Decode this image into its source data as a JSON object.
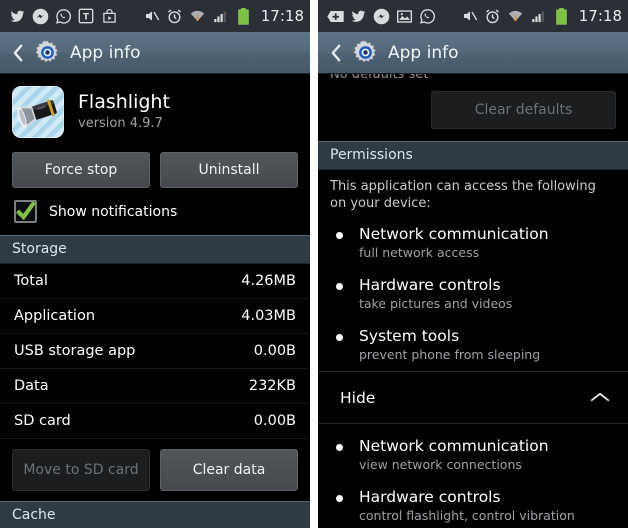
{
  "left": {
    "statusbar": {
      "icons": [
        "twitter-icon",
        "messenger-icon",
        "whatsapp-icon",
        "tumblr-icon",
        "play-store-icon",
        "mute-icon",
        "alarm-icon",
        "wifi-icon",
        "signal-icon",
        "battery-icon"
      ],
      "time": "17:18"
    },
    "actionbar": {
      "back_icon": "back-chevron-icon",
      "app_icon": "settings-gear-icon",
      "title": "App info"
    },
    "app": {
      "icon": "flashlight-app-icon",
      "name": "Flashlight",
      "version": "version 4.9.7"
    },
    "buttons": {
      "force_stop": "Force stop",
      "uninstall": "Uninstall"
    },
    "notifications": {
      "label": "Show notifications",
      "checked": true,
      "check_color": "#7cc142"
    },
    "storage": {
      "header": "Storage",
      "rows": [
        {
          "label": "Total",
          "value": "4.26MB"
        },
        {
          "label": "Application",
          "value": "4.03MB"
        },
        {
          "label": "USB storage app",
          "value": "0.00B"
        },
        {
          "label": "Data",
          "value": "232KB"
        },
        {
          "label": "SD card",
          "value": "0.00B"
        }
      ],
      "move_to_sd": "Move to SD card",
      "clear_data": "Clear data"
    },
    "cache": {
      "header": "Cache"
    }
  },
  "right": {
    "statusbar": {
      "icons": [
        "plus-badge-icon",
        "twitter-icon",
        "messenger-icon",
        "gallery-icon",
        "whatsapp-icon",
        "mute-icon",
        "alarm-icon",
        "wifi-icon",
        "signal-icon",
        "battery-icon"
      ],
      "time": "17:18"
    },
    "actionbar": {
      "back_icon": "back-chevron-icon",
      "app_icon": "settings-gear-icon",
      "title": "App info"
    },
    "defaults": {
      "cut_text": "No defaults set",
      "clear_defaults": "Clear defaults"
    },
    "permissions": {
      "header": "Permissions",
      "intro": "This application can access the following on your device:",
      "items": [
        {
          "title": "Network communication",
          "desc": "full network access"
        },
        {
          "title": "Hardware controls",
          "desc": "take pictures and videos"
        },
        {
          "title": "System tools",
          "desc": "prevent phone from sleeping"
        }
      ]
    },
    "hide": {
      "label": "Hide",
      "chevron": "chevron-up-icon"
    },
    "hidden_permissions": {
      "items": [
        {
          "title": "Network communication",
          "desc": "view network connections"
        },
        {
          "title": "Hardware controls",
          "desc": "control flashlight, control vibration"
        }
      ]
    }
  }
}
